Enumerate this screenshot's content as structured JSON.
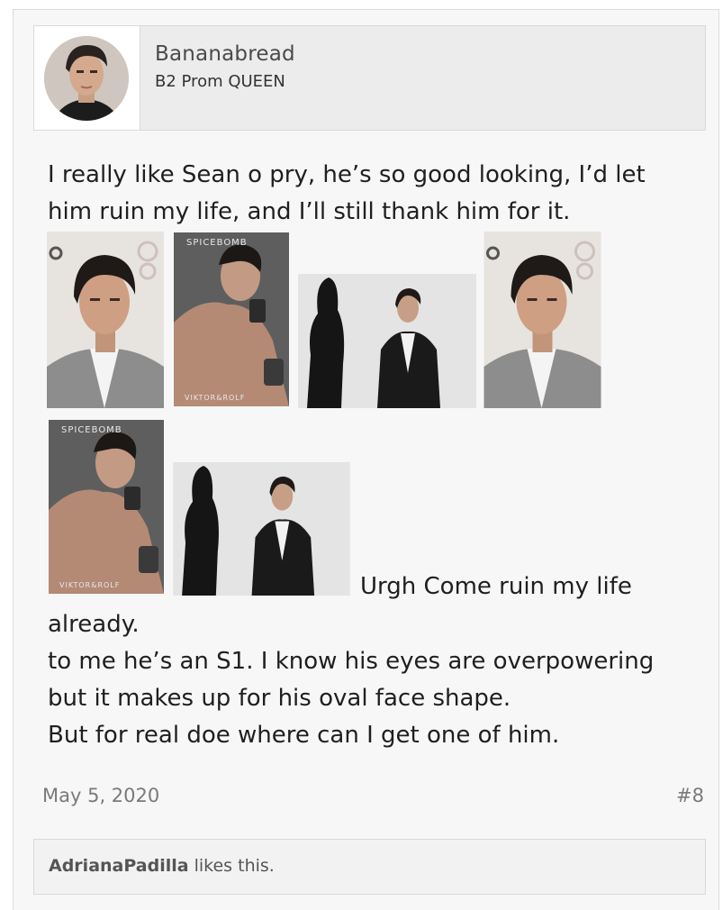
{
  "user": {
    "name": "Bananabread",
    "title": "B2 Prom QUEEN"
  },
  "post": {
    "lines_top": [
      "I really like Sean o pry, he’s so good looking, I’d let",
      "him ruin my life, and I’ll still thank him for it."
    ],
    "images": [
      {
        "name": "sean-opry-suit-photo",
        "caption": ""
      },
      {
        "name": "spicebomb-ad-photo",
        "caption": "SPICEBOMB",
        "brand": "VIKTOR&ROLF"
      },
      {
        "name": "sean-opry-silhouette-photo",
        "caption": ""
      },
      {
        "name": "sean-opry-suit-photo-2",
        "caption": ""
      },
      {
        "name": "spicebomb-ad-photo-2",
        "caption": "SPICEBOMB",
        "brand": "VIKTOR&ROLF"
      },
      {
        "name": "sean-opry-silhouette-photo-2",
        "caption": ""
      }
    ],
    "inline_text": "Urgh Come ruin my life",
    "lines_bottom": [
      "already.",
      "to me he’s an S1. I know his eyes are overpowering",
      "but it makes up for his oval face shape.",
      "But for real doe where can I get one of him."
    ],
    "date": "May 5, 2020",
    "number": "#8"
  },
  "likes": {
    "liker": "AdrianaPadilla",
    "suffix": " likes this."
  },
  "colors": {
    "post_bg": "#f7f7f7",
    "card_bg": "#ececec",
    "border": "#d9d9d9",
    "meta_text": "#7a7a7a"
  }
}
